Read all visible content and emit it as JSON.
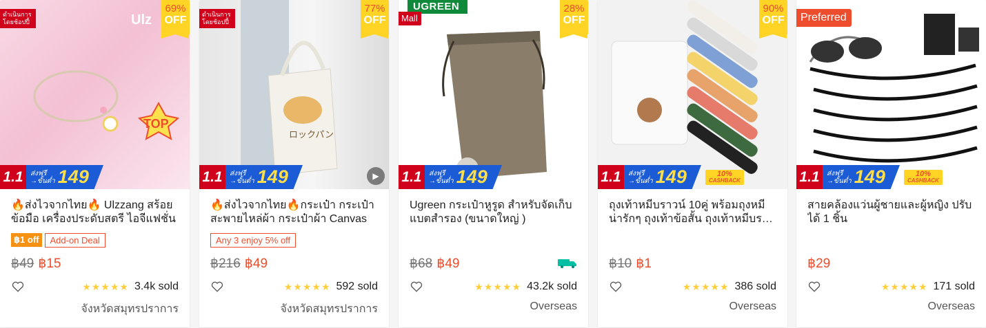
{
  "promo": {
    "d11": "1.1",
    "fs_top": "ส่งฟรี",
    "fs_bottom": "ขั้นต่ำ",
    "fs_num": "149",
    "cb_top": "10%",
    "cb_bottom": "CASHBACK"
  },
  "products": [
    {
      "name": "🔥ส่งไวจากไทย🔥 Ulzzang สร้อยข้อมือ เครื่องประดับสตรี ไอจีแฟชั่น",
      "discount_pct": "69%",
      "discount_off": "OFF",
      "tag": "ดำเนินการโดยช้อปปี้",
      "tag_line1": "ดำเนินการ",
      "tag_line2": "โดยช้อปปี้",
      "badge_off": "฿1 off",
      "badge_deal": "Add-on Deal",
      "price_original": "฿49",
      "price": "฿15",
      "rating": "★★★★★",
      "sold": "3.4k sold",
      "location": "จังหวัดสมุทรปราการ"
    },
    {
      "name": "🔥ส่งไวจากไทย🔥กระเป๋า กระเป๋าสะพายไหล่ผ้า กระเป๋าผ้า Canvas",
      "discount_pct": "77%",
      "discount_off": "OFF",
      "tag_line1": "ดำเนินการ",
      "tag_line2": "โดยช้อปปี้",
      "badge_deal": "Any 3 enjoy 5% off",
      "price_original": "฿216",
      "price": "฿49",
      "rating": "★★★★★",
      "sold": "592 sold",
      "location": "จังหวัดสมุทรปราการ"
    },
    {
      "name": "Ugreen กระเป๋าหูรูด สำหรับจัดเก็บแบตสำรอง (ขนาดใหญ่ )",
      "discount_pct": "28%",
      "discount_off": "OFF",
      "brand": "UGREEN",
      "mall": "Mall",
      "price_original": "฿68",
      "price": "฿49",
      "rating": "★★★★★",
      "sold": "43.2k sold",
      "location": "Overseas"
    },
    {
      "name": "ถุงเท้าหมีบราวน์ 10คู่ พร้อมถุงหมี น่ารักๆ ถุงเท้าข้อสั้น ถุงเท้าหมีบราวน์",
      "discount_pct": "90%",
      "discount_off": "OFF",
      "price_original": "฿10",
      "price": "฿1",
      "rating": "★★★★★",
      "sold": "386 sold",
      "location": "Overseas"
    },
    {
      "name": "สายคล้องแว่นผู้ชายและผู้หญิง ปรับได้ 1 ชิ้น",
      "preferred": "Preferred",
      "price": "฿29",
      "rating": "★★★★★",
      "sold": "171 sold",
      "location": "Overseas"
    }
  ]
}
